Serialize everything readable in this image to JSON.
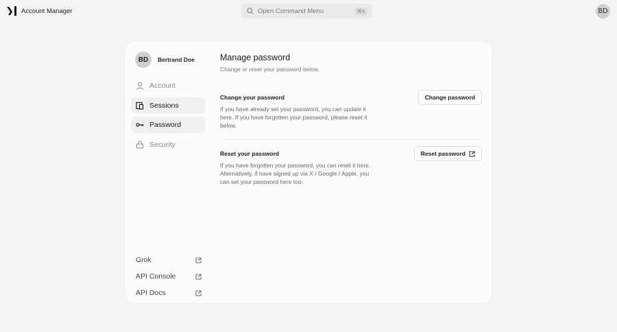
{
  "header": {
    "app_title": "Account Manager",
    "command_placeholder": "Open Command Menu",
    "shortcut": "⌘K",
    "avatar": "BD"
  },
  "sidebar": {
    "user_initials": "BD",
    "user_name": "Bertrand Doe",
    "items": [
      {
        "label": "Account",
        "icon": "user-icon"
      },
      {
        "label": "Sessions",
        "icon": "devices-icon"
      },
      {
        "label": "Password",
        "icon": "key-icon"
      },
      {
        "label": "Security",
        "icon": "lock-icon"
      }
    ],
    "links": [
      {
        "label": "Grok"
      },
      {
        "label": "API Console"
      },
      {
        "label": "API Docs"
      }
    ]
  },
  "main": {
    "title": "Manage password",
    "subtitle": "Change or reset your password below.",
    "change": {
      "title": "Change your password",
      "text": "If you have already set your password, you can update it here. If you have forgotten your password, please reset it below.",
      "button": "Change password"
    },
    "reset": {
      "title": "Reset your password",
      "text": "If you have forgotten your password, you can reset it here. Alternatively, if have signed up via X / Google / Apple, you can set your password here too.",
      "button": "Reset password"
    }
  }
}
